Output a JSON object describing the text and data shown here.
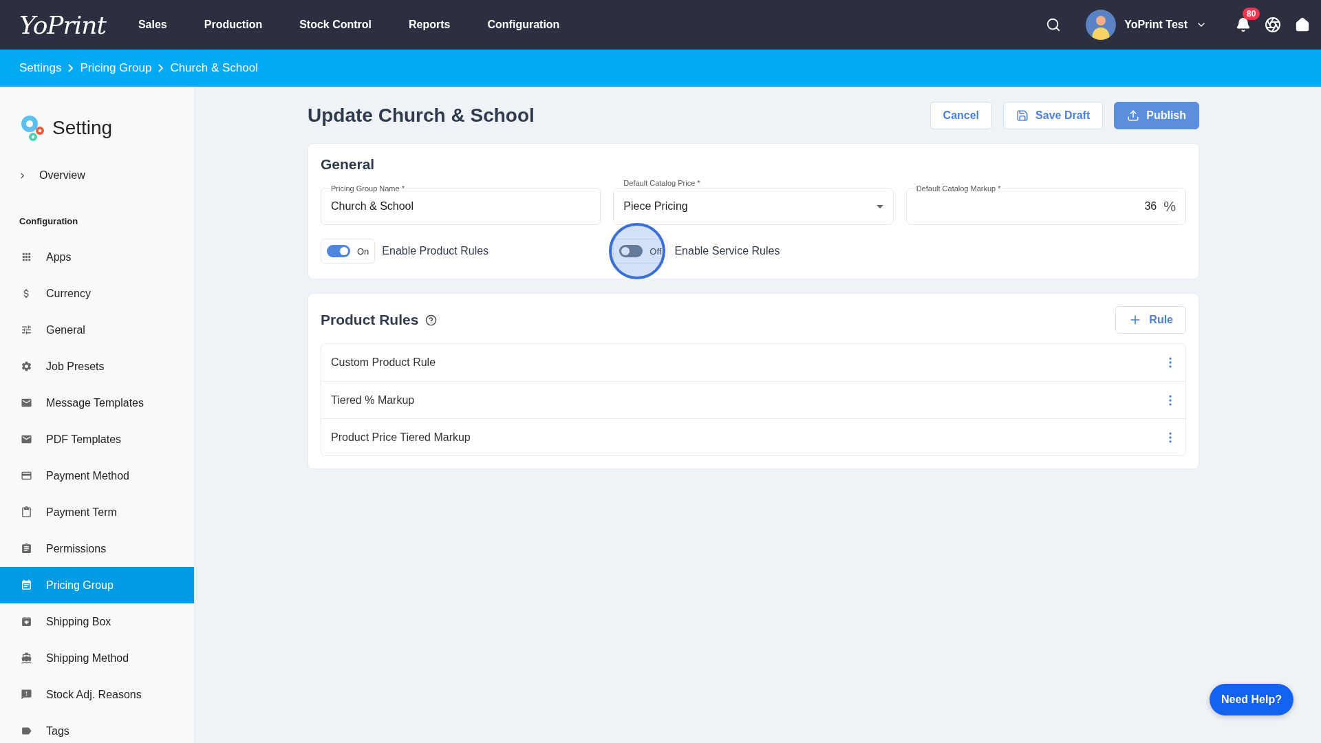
{
  "topbar": {
    "logo": "YoPrint",
    "nav": [
      {
        "label": "Sales"
      },
      {
        "label": "Production"
      },
      {
        "label": "Stock Control"
      },
      {
        "label": "Reports"
      },
      {
        "label": "Configuration"
      }
    ],
    "user": {
      "name": "YoPrint Test"
    },
    "notifications": {
      "count": "80"
    }
  },
  "breadcrumb": [
    "Settings",
    "Pricing Group",
    "Church & School"
  ],
  "sidebar": {
    "title": "Setting",
    "overview": "Overview",
    "section": "Configuration",
    "items": [
      {
        "label": "Apps",
        "selected": false
      },
      {
        "label": "Currency",
        "selected": false
      },
      {
        "label": "General",
        "selected": false
      },
      {
        "label": "Job Presets",
        "selected": false
      },
      {
        "label": "Message Templates",
        "selected": false
      },
      {
        "label": "PDF Templates",
        "selected": false
      },
      {
        "label": "Payment Method",
        "selected": false
      },
      {
        "label": "Payment Term",
        "selected": false
      },
      {
        "label": "Permissions",
        "selected": false
      },
      {
        "label": "Pricing Group",
        "selected": true
      },
      {
        "label": "Shipping Box",
        "selected": false
      },
      {
        "label": "Shipping Method",
        "selected": false
      },
      {
        "label": "Stock Adj. Reasons",
        "selected": false
      },
      {
        "label": "Tags",
        "selected": false
      }
    ]
  },
  "page": {
    "title": "Update Church & School",
    "buttons": {
      "cancel": "Cancel",
      "save_draft": "Save Draft",
      "publish": "Publish"
    }
  },
  "general": {
    "title": "General",
    "fields": [
      {
        "kind": "text",
        "label": "Pricing Group Name *",
        "value": "Church & School"
      },
      {
        "kind": "select",
        "label": "Default Catalog Price *",
        "value": "Piece Pricing"
      },
      {
        "kind": "number",
        "label": "Default Catalog Markup *",
        "value": "36",
        "suffix": "%"
      }
    ],
    "toggles": [
      {
        "label": "Enable Product Rules",
        "state_text": "On",
        "on": true,
        "highlighted": false
      },
      {
        "label": "Enable Service Rules",
        "state_text": "Off",
        "on": false,
        "highlighted": true
      }
    ]
  },
  "product_rules": {
    "title": "Product Rules",
    "add_button": "Rule",
    "rows": [
      "Custom Product Rule",
      "Tiered % Markup",
      "Product Price Tiered Markup"
    ]
  },
  "help_button": "Need Help?"
}
